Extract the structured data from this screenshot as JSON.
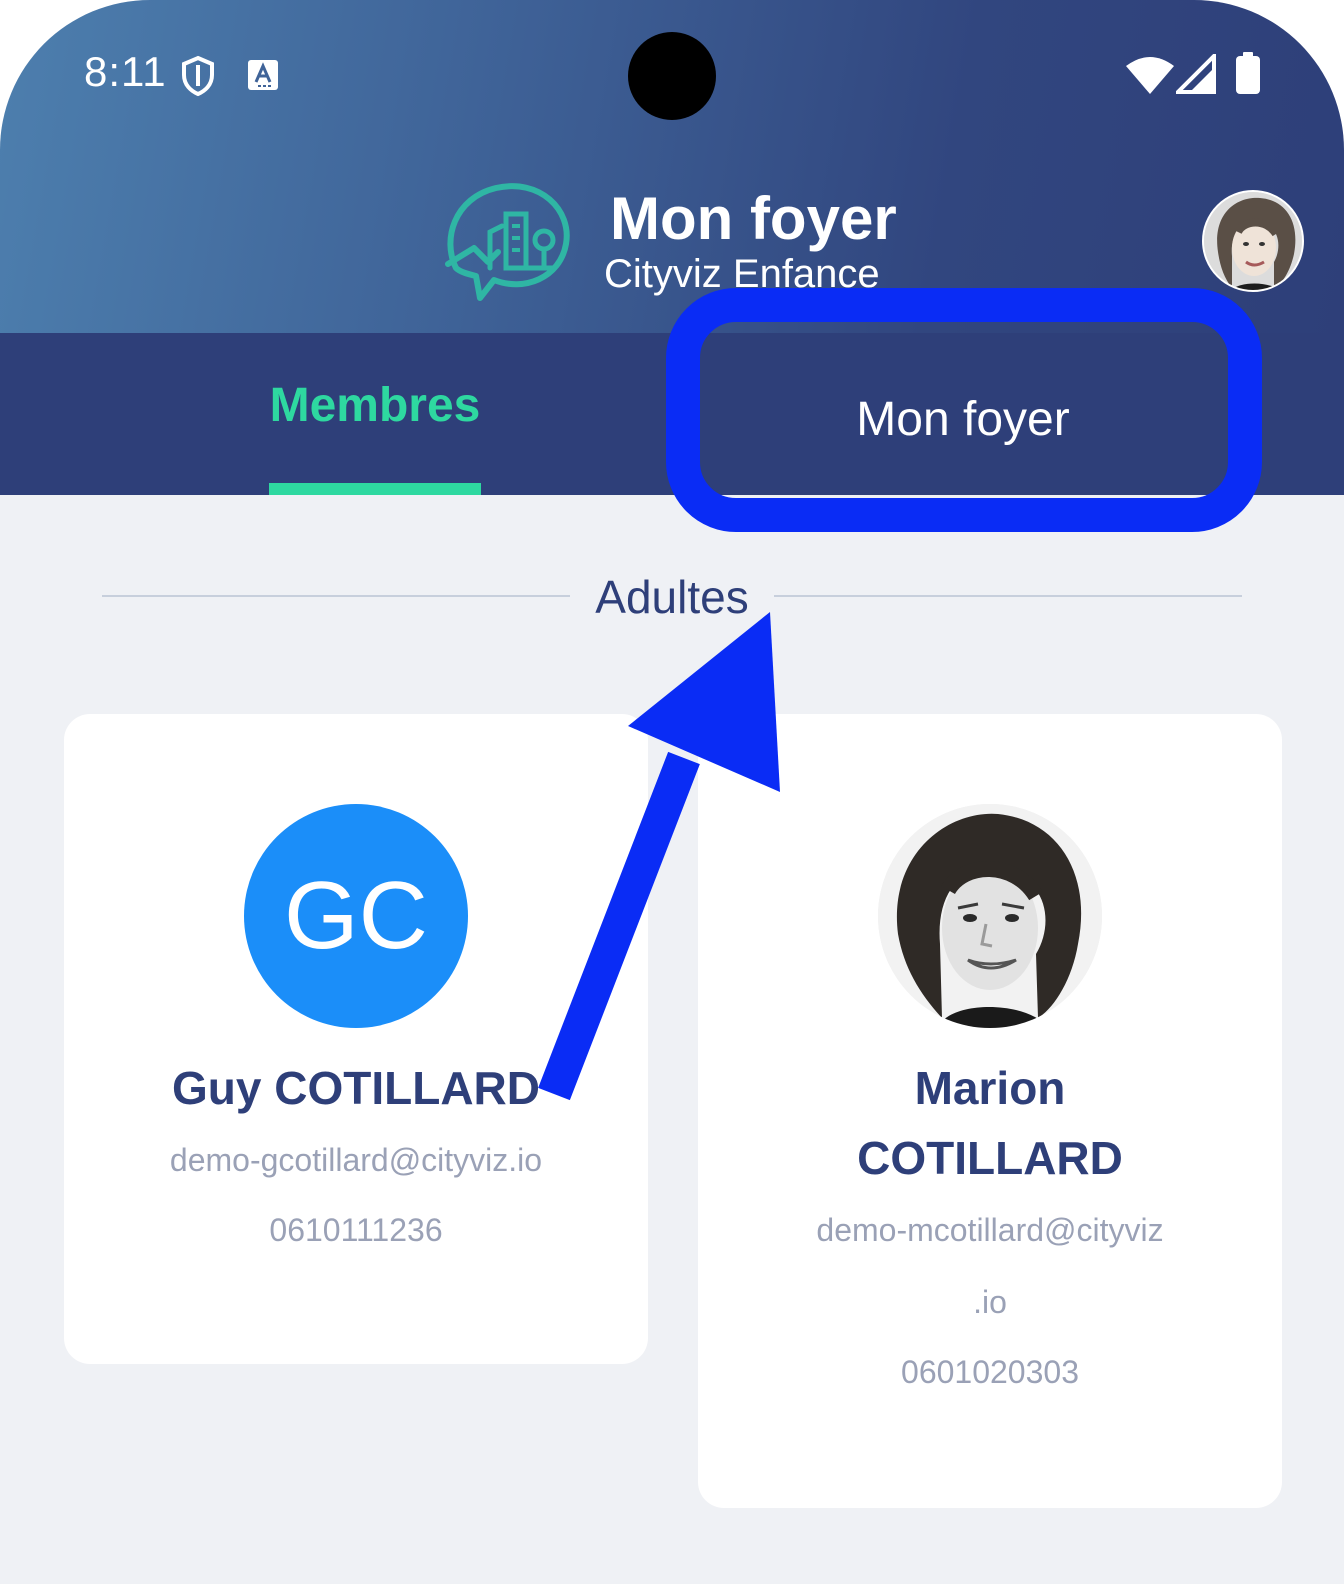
{
  "status_bar": {
    "time": "8:11",
    "icons": [
      "shield-icon",
      "font-a-icon",
      "wifi-icon",
      "signal-icon",
      "battery-icon"
    ]
  },
  "header": {
    "title": "Mon foyer",
    "subtitle": "Cityviz Enfance",
    "logo": "cityviz-logo-icon",
    "avatar": "user-avatar"
  },
  "tabs": [
    {
      "label": "Membres",
      "active": true
    },
    {
      "label": "Mon foyer",
      "active": false
    }
  ],
  "section": {
    "title": "Adultes"
  },
  "members": [
    {
      "initials": "GC",
      "name": "Guy COTILLARD",
      "email": "demo-gcotillard@cityviz.io",
      "phone": "0610111236"
    },
    {
      "name_line1": "Marion",
      "name_line2": "COTILLARD",
      "email_line1": "demo-mcotillard@cityviz",
      "email_line2": ".io",
      "phone": "0601020303"
    }
  ],
  "colors": {
    "header_gradient_start": "#4d7fae",
    "header_gradient_end": "#2e3f79",
    "tab_bar": "#2e3f79",
    "active_tab": "#2ed8a0",
    "annotation": "#0a2cf5",
    "avatar_blue": "#1b8ef9",
    "name_text": "#2e3f79",
    "info_text": "#9aa1b6",
    "background": "#eff1f5"
  }
}
